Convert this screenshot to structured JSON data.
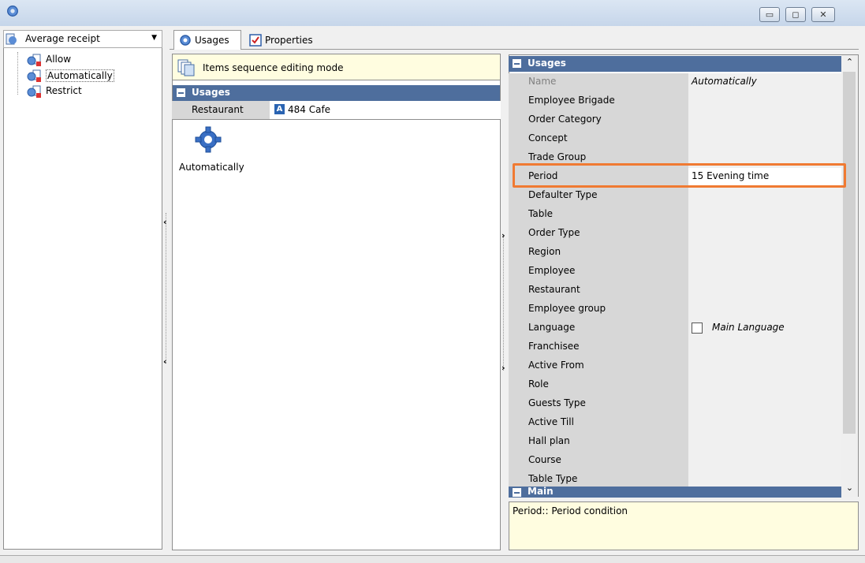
{
  "window": {
    "title": "",
    "buttons": [
      "minimize",
      "maximize",
      "close"
    ]
  },
  "left_panel": {
    "combo_value": "Average receipt",
    "tree_items": [
      {
        "label": "Allow"
      },
      {
        "label": "Automatically",
        "selected": true
      },
      {
        "label": "Restrict"
      }
    ]
  },
  "tabs": [
    {
      "label": "Usages",
      "active": true,
      "icon": "gear-icon"
    },
    {
      "label": "Properties",
      "active": false,
      "icon": "properties-icon"
    }
  ],
  "middle": {
    "mode_label": "Items sequence editing mode",
    "group_title": "Usages",
    "row_key": "Restaurant",
    "row_badge": "A",
    "row_value": "484 Cafe",
    "item_label": "Automatically"
  },
  "grid": {
    "group_title": "Usages",
    "rows": [
      {
        "key": "Name",
        "value": "Automatically",
        "dim": true
      },
      {
        "key": "Employee Brigade",
        "value": ""
      },
      {
        "key": "Order Category",
        "value": ""
      },
      {
        "key": "Concept",
        "value": ""
      },
      {
        "key": "Trade Group",
        "value": ""
      },
      {
        "key": "Period",
        "value": "15 Evening time",
        "highlighted": true
      },
      {
        "key": "Defaulter Type",
        "value": ""
      },
      {
        "key": "Table",
        "value": ""
      },
      {
        "key": "Order Type",
        "value": ""
      },
      {
        "key": "Region",
        "value": ""
      },
      {
        "key": "Employee",
        "value": ""
      },
      {
        "key": "Restaurant",
        "value": ""
      },
      {
        "key": "Employee group",
        "value": ""
      },
      {
        "key": "Language",
        "value": "Main Language",
        "checkbox": true
      },
      {
        "key": "Franchisee",
        "value": ""
      },
      {
        "key": "Active From",
        "value": ""
      },
      {
        "key": "Role",
        "value": ""
      },
      {
        "key": "Guests Type",
        "value": ""
      },
      {
        "key": "Active Till",
        "value": ""
      },
      {
        "key": "Hall plan",
        "value": ""
      },
      {
        "key": "Course",
        "value": ""
      },
      {
        "key": "Table Type",
        "value": ""
      }
    ],
    "next_group_title": "Main"
  },
  "description": "Period:: Period condition",
  "colors": {
    "group_header": "#4e6e9d",
    "highlight": "#f07a32",
    "info_bg": "#fffde0"
  }
}
